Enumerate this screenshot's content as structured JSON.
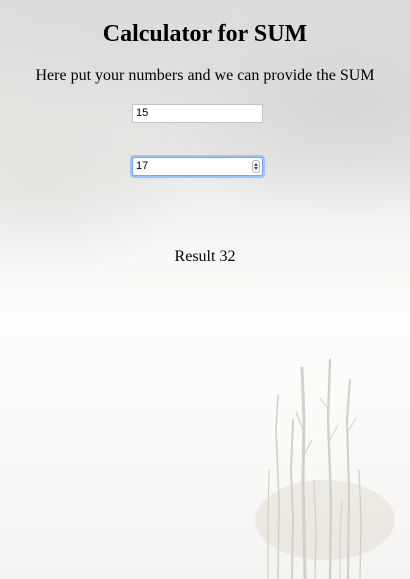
{
  "header": {
    "title": "Calculator for SUM",
    "subtitle": "Here put your numbers and we can provide the SUM"
  },
  "form": {
    "first_number": "15",
    "second_number": "17"
  },
  "result": {
    "label": "Result",
    "value": "32"
  }
}
